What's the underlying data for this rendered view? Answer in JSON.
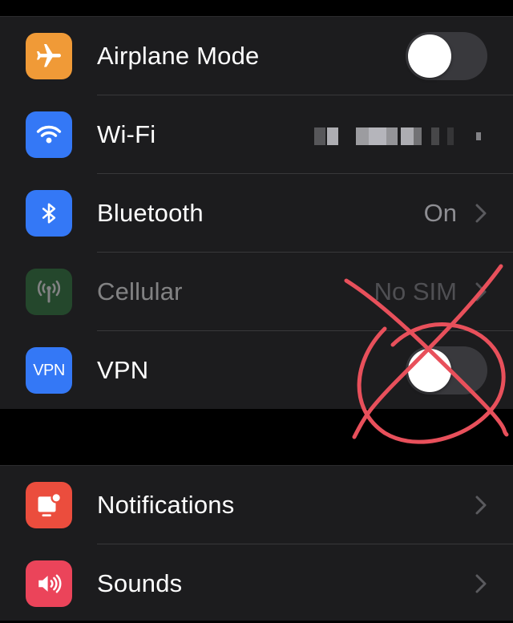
{
  "colors": {
    "airplane": "#f09a37",
    "wifi": "#3478f6",
    "bluetooth": "#3478f6",
    "cellular": "#2f7d3e",
    "vpn": "#3478f6",
    "notifications": "#eb4d3d",
    "sounds": "#eb445a",
    "annotation": "#e8505b"
  },
  "network_group": {
    "airplane": {
      "label": "Airplane Mode",
      "icon": "airplane-icon",
      "toggle_on": false
    },
    "wifi": {
      "label": "Wi-Fi",
      "icon": "wifi-icon",
      "value": ""
    },
    "bluetooth": {
      "label": "Bluetooth",
      "icon": "bluetooth-icon",
      "value": "On"
    },
    "cellular": {
      "label": "Cellular",
      "icon": "cellular-antenna-icon",
      "value": "No SIM"
    },
    "vpn": {
      "label": "VPN",
      "icon_text": "VPN",
      "toggle_on": false
    }
  },
  "system_group": {
    "notifications": {
      "label": "Notifications",
      "icon": "bell-icon"
    },
    "sounds": {
      "label": "Sounds",
      "icon": "speaker-icon"
    }
  }
}
